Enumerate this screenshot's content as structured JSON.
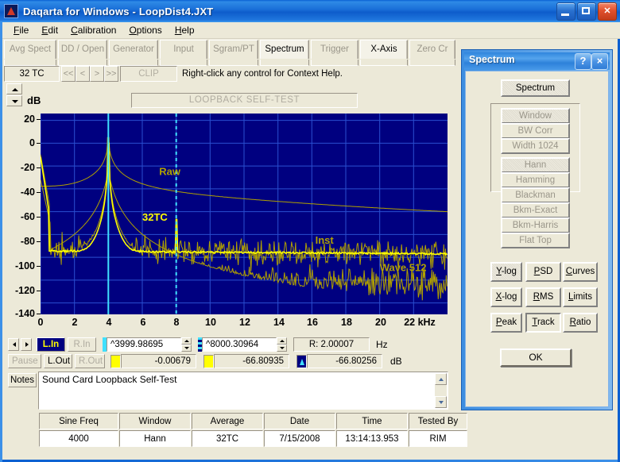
{
  "window": {
    "title": "Daqarta for Windows   -   LoopDist4.JXT",
    "icon": "daqarta-app-icon",
    "minimize": "minimize-icon",
    "maximize": "maximize-icon",
    "close": "close-icon"
  },
  "menu": [
    "File",
    "Edit",
    "Calibration",
    "Options",
    "Help"
  ],
  "tabs": [
    {
      "label": "Avg Spect",
      "active": false
    },
    {
      "label": "DD / Open",
      "active": false
    },
    {
      "label": "Generator",
      "active": false
    },
    {
      "label": "Input",
      "active": false
    },
    {
      "label": "Sgram/PT",
      "active": false
    },
    {
      "label": "Spectrum",
      "active": true
    },
    {
      "label": "Trigger",
      "active": false
    },
    {
      "label": "X-Axis",
      "active": true
    },
    {
      "label": "Zero Cr",
      "active": false
    }
  ],
  "toolbar2": {
    "tc": "32 TC",
    "nav": [
      "<<",
      "<",
      ">",
      ">>"
    ],
    "clip": "CLIP",
    "hint": "Right-click any control for Context Help."
  },
  "graph": {
    "y_unit": "dB",
    "selftest_banner": "LOOPBACK SELF-TEST",
    "spinner_up": "up-arrow-icon",
    "spinner_down": "down-arrow-icon"
  },
  "chart_data": {
    "type": "line",
    "title": "LOOPBACK SELF-TEST",
    "xlabel": "kHz",
    "ylabel": "dB",
    "xlim": [
      0,
      24
    ],
    "ylim": [
      -150,
      26
    ],
    "xticks": [
      0,
      2,
      4,
      6,
      8,
      10,
      12,
      14,
      16,
      18,
      20,
      22
    ],
    "xtick_labels": [
      "0",
      "2",
      "4",
      "6",
      "8",
      "10",
      "12",
      "14",
      "16",
      "18",
      "20",
      "22 kHz"
    ],
    "yticks": [
      20,
      0,
      -20,
      -40,
      -60,
      -80,
      -100,
      -120,
      -140
    ],
    "ytick_labels": [
      "20",
      "0",
      "-20",
      "-40",
      "-60",
      "-80",
      "-100",
      "-120",
      "-140"
    ],
    "grid": true,
    "bg_color": "#000080",
    "grid_color": "#2a4fd0",
    "annotations": [
      {
        "text": "Raw",
        "x": 7.0,
        "y": -28,
        "color": "#b0a000"
      },
      {
        "text": "32TC",
        "x": 6.0,
        "y": -68,
        "color": "#ffff00"
      },
      {
        "text": "Inst",
        "x": 16.2,
        "y": -88,
        "color": "#b0a000"
      },
      {
        "text": "Wave 512",
        "x": 20.0,
        "y": -112,
        "color": "#b0a000"
      }
    ],
    "cursors": [
      {
        "name": "cursor-1-solid",
        "x": 3.99998695,
        "style": "solid",
        "color": "#40e0ff"
      },
      {
        "name": "cursor-2-dashed",
        "x": 8.00030964,
        "style": "dashed",
        "color": "#40e0ff"
      }
    ],
    "series": [
      {
        "name": "Raw",
        "color": "#b0a000",
        "note": "smooth skirted sine peak at 4 kHz, decaying to ~-65 dB at 24 kHz"
      },
      {
        "name": "32TC",
        "color": "#ffff00",
        "note": "32 time-constant averaged spectrum, peak 0 dB at 4 kHz, noise floor ~-95 dB"
      },
      {
        "name": "Inst",
        "color": "#b0a000",
        "note": "instantaneous noisy spectrum, floor ~-95 dB with scatter"
      },
      {
        "name": "Wave 512",
        "color": "#b0a000",
        "note": "lower noisy trace, floor ~-120 dB"
      }
    ],
    "peaks": [
      {
        "freq_khz": 4.0,
        "level_db": 0.0,
        "label": "fundamental"
      },
      {
        "freq_khz": 8.0,
        "level_db": -66.8,
        "label": "2nd harmonic"
      }
    ]
  },
  "readouts": {
    "nav_left": "left-arrow-icon",
    "nav_right": "right-arrow-icon",
    "lin": "L.In",
    "rin": "R.In",
    "pause": "Pause",
    "lout": "L.Out",
    "rout": "R.Out",
    "cursor1_freq": "^3999.98695",
    "cursor2_freq": "^8000.30964",
    "ratio": "R:  2.00007",
    "freq_unit": "Hz",
    "cursor1_level": "-0.00679",
    "cursor2_level": "-66.80935",
    "delta_level": "-66.80256",
    "level_unit": "dB"
  },
  "notes": {
    "label": "Notes",
    "text": "Sound Card Loopback Self-Test",
    "scroll_up": "scroll-up-icon",
    "scroll_down": "scroll-down-icon"
  },
  "info_table": {
    "headers": [
      "Sine Freq",
      "Window",
      "Average",
      "Date",
      "Time",
      "Tested By"
    ],
    "values": [
      "4000",
      "Hann",
      "32TC",
      "7/15/2008",
      "13:14:13.953",
      "RIM"
    ]
  },
  "dialog": {
    "title": "Spectrum",
    "help": "?",
    "close": "×",
    "spectrum_toggle": "Spectrum",
    "window_group": {
      "window": "Window",
      "bw_corr": "BW Corr",
      "width": "Width 1024",
      "types": [
        "Hann",
        "Hamming",
        "Blackman",
        "Bkm-Exact",
        "Bkm-Harris",
        "Flat Top"
      ],
      "selected_type": "Hann"
    },
    "row_ylog": [
      "Y-log",
      "PSD",
      "Curves"
    ],
    "row_xlog": [
      "X-log",
      "RMS",
      "Limits"
    ],
    "row_peak": [
      "Peak",
      "Track",
      "Ratio"
    ],
    "ok": "OK"
  },
  "colors": {
    "plot_bg": "#000080",
    "grid": "#2a4fd0",
    "trace_bright": "#ffff00",
    "trace_dim": "#b0a000",
    "cursor": "#40e0ff",
    "titlebar_blue": "#0b61d4",
    "face": "#ece9d8"
  }
}
